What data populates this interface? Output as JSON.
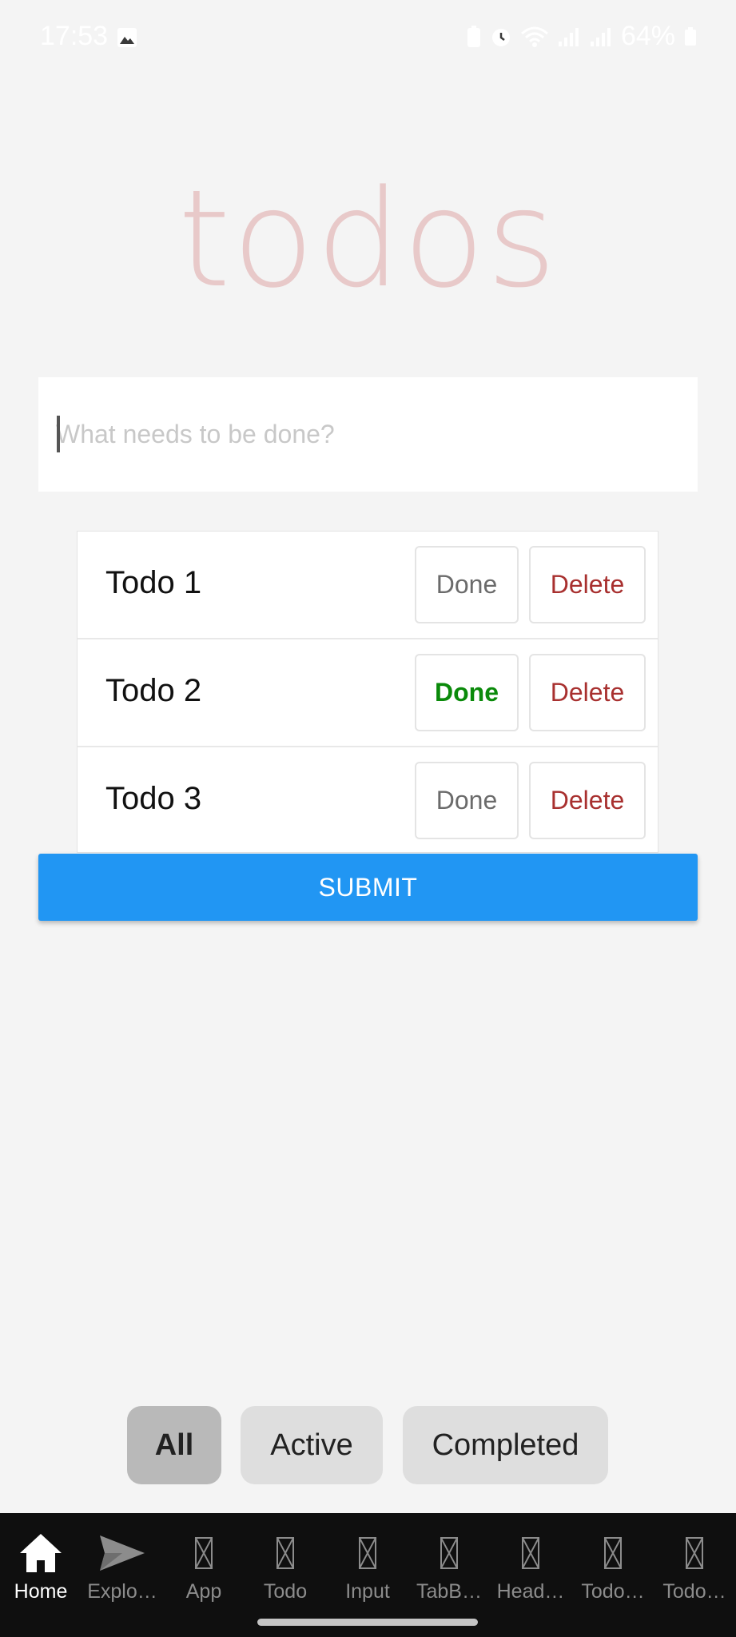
{
  "status_bar": {
    "time": "17:53",
    "battery": "64%"
  },
  "header": {
    "title": "todos"
  },
  "input": {
    "placeholder": "What needs to be done?",
    "value": ""
  },
  "todos": [
    {
      "label": "Todo 1",
      "done_label": "Done",
      "delete_label": "Delete",
      "done": false
    },
    {
      "label": "Todo 2",
      "done_label": "Done",
      "delete_label": "Delete",
      "done": true
    },
    {
      "label": "Todo 3",
      "done_label": "Done",
      "delete_label": "Delete",
      "done": false
    }
  ],
  "submit": {
    "label": "SUBMIT"
  },
  "filters": [
    {
      "label": "All",
      "selected": true
    },
    {
      "label": "Active",
      "selected": false
    },
    {
      "label": "Completed",
      "selected": false
    }
  ],
  "bottom_nav": [
    {
      "label": "Home",
      "icon": "home-icon",
      "active": true
    },
    {
      "label": "Explo…",
      "icon": "send-icon",
      "active": false
    },
    {
      "label": "App",
      "icon": "missing-glyph-icon",
      "active": false
    },
    {
      "label": "Todo",
      "icon": "missing-glyph-icon",
      "active": false
    },
    {
      "label": "Input",
      "icon": "missing-glyph-icon",
      "active": false
    },
    {
      "label": "TabB…",
      "icon": "missing-glyph-icon",
      "active": false
    },
    {
      "label": "Head…",
      "icon": "missing-glyph-icon",
      "active": false
    },
    {
      "label": "Todo…",
      "icon": "missing-glyph-icon",
      "active": false
    },
    {
      "label": "Todo…",
      "icon": "missing-glyph-icon",
      "active": false
    }
  ],
  "colors": {
    "accent": "#2196f3",
    "done_active": "#0a8a0a",
    "delete": "#a8302f",
    "title": "#e8c9c9"
  }
}
